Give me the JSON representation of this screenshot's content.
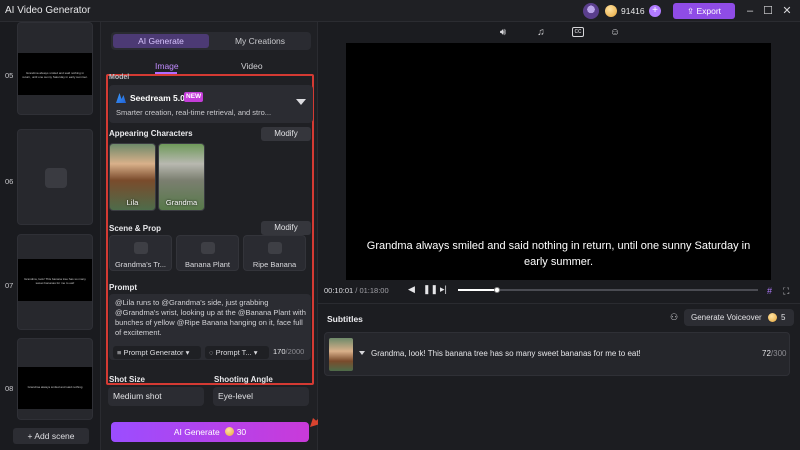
{
  "titlebar": {
    "title": "AI Video Generator",
    "credits": "91416",
    "plus": "+",
    "export_label": "Export",
    "export_icon": "upload-icon"
  },
  "scenes": {
    "items": [
      {
        "number": "05",
        "text": "Grandma always smiled and said nothing in return, until one sunny Saturday in early summer."
      },
      {
        "number": "06",
        "text": ""
      },
      {
        "number": "07",
        "text": "Grandma, look! This banana tree has so many sweet bananas for me to eat!"
      },
      {
        "number": "08",
        "text": "Grandma always smiled and said nothing"
      }
    ],
    "add_label": "+ Add scene"
  },
  "panel": {
    "tabs": [
      "AI Generate",
      "My Creations"
    ],
    "subtabs": [
      "Image",
      "Video"
    ],
    "model_label": "Model",
    "model": {
      "name": "Seedream 5.0",
      "badge": "NEW",
      "desc": "Smarter creation, real-time retrieval, and stro..."
    },
    "characters_label": "Appearing Characters",
    "modify_label": "Modify",
    "characters": [
      "Lila",
      "Grandma"
    ],
    "scene_label": "Scene & Prop",
    "props": [
      "Grandma's Tr...",
      "Banana Plant",
      "Ripe Banana"
    ],
    "prompt_label": "Prompt",
    "prompt_text": "@Lila runs to @Grandma's side, just grabbing @Grandma's wrist, looking up at the @Banana Plant with bunches of yellow @Ripe Banana hanging on it, face full of excitement.",
    "prompt_generator": "Prompt Generator",
    "prompt_template": "Prompt T...",
    "prompt_count": "170",
    "prompt_max": "/2000",
    "shot_size_label": "Shot Size",
    "shot_size_value": "Medium shot",
    "angle_label": "Shooting Angle",
    "angle_value": "Eye-level",
    "generate_label": "AI Generate",
    "generate_cost": "30"
  },
  "preview": {
    "caption": "Grandma always smiled and said nothing in return, until one sunny Saturday in early summer.",
    "current_time": "00:10:01",
    "total_time": " / 01:18:00",
    "progress": 0.13
  },
  "subtitles": {
    "title": "Subtitles",
    "voiceover_label": "Generate Voiceover",
    "voiceover_cost": "5",
    "row_text": "Grandma, look! This banana tree has so many sweet bananas for me to eat!",
    "row_count": "72",
    "row_max": "/300"
  },
  "colors": {
    "accent": "#9b4dff",
    "highlight_box": "#d43a33",
    "background": "#1b1c20"
  }
}
